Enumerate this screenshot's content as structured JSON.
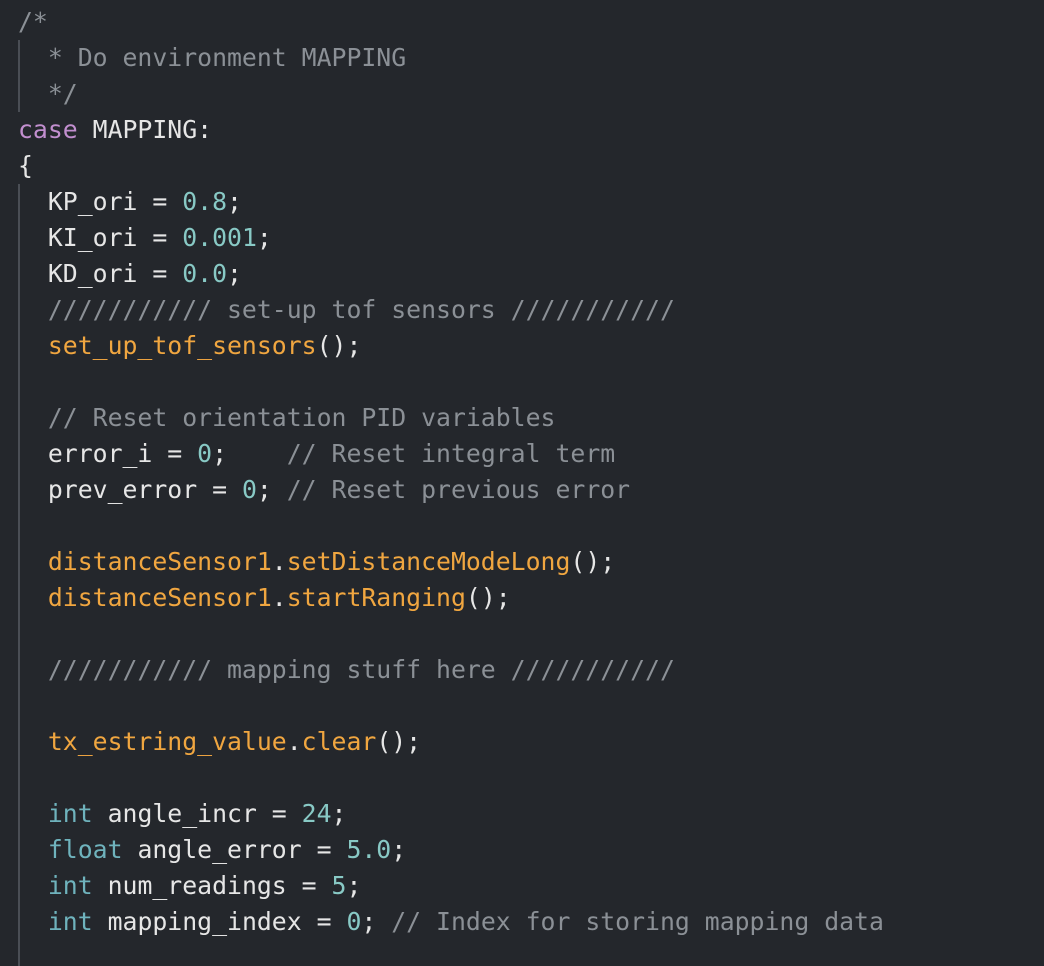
{
  "theme": {
    "background": "#24272c",
    "colors": {
      "plain": "#e6e6e6",
      "comment": "#8b9096",
      "keyword": "#c28fcf",
      "number": "#88c9c5",
      "function": "#f0a640",
      "type": "#6fb3bd",
      "indent_guide": "#4a4e55"
    }
  },
  "code": {
    "lines": [
      [
        [
          "comment",
          "/*"
        ]
      ],
      [
        [
          "comment",
          "  * Do environment MAPPING"
        ]
      ],
      [
        [
          "comment",
          "  */"
        ]
      ],
      [
        [
          "keyword",
          "case"
        ],
        [
          "plain",
          " MAPPING:"
        ]
      ],
      [
        [
          "plain",
          "{"
        ]
      ],
      [
        [
          "plain",
          "  KP_ori = "
        ],
        [
          "number",
          "0.8"
        ],
        [
          "plain",
          ";"
        ]
      ],
      [
        [
          "plain",
          "  KI_ori = "
        ],
        [
          "number",
          "0.001"
        ],
        [
          "plain",
          ";"
        ]
      ],
      [
        [
          "plain",
          "  KD_ori = "
        ],
        [
          "number",
          "0.0"
        ],
        [
          "plain",
          ";"
        ]
      ],
      [
        [
          "comment",
          "  /////////// set-up tof sensors ///////////"
        ]
      ],
      [
        [
          "plain",
          "  "
        ],
        [
          "func",
          "set_up_tof_sensors"
        ],
        [
          "plain",
          "();"
        ]
      ],
      [],
      [
        [
          "comment",
          "  // Reset orientation PID variables"
        ]
      ],
      [
        [
          "plain",
          "  error_i = "
        ],
        [
          "number",
          "0"
        ],
        [
          "plain",
          ";    "
        ],
        [
          "comment",
          "// Reset integral term"
        ]
      ],
      [
        [
          "plain",
          "  prev_error = "
        ],
        [
          "number",
          "0"
        ],
        [
          "plain",
          "; "
        ],
        [
          "comment",
          "// Reset previous error"
        ]
      ],
      [],
      [
        [
          "plain",
          "  "
        ],
        [
          "func",
          "distanceSensor1"
        ],
        [
          "plain",
          "."
        ],
        [
          "func",
          "setDistanceModeLong"
        ],
        [
          "plain",
          "();"
        ]
      ],
      [
        [
          "plain",
          "  "
        ],
        [
          "func",
          "distanceSensor1"
        ],
        [
          "plain",
          "."
        ],
        [
          "func",
          "startRanging"
        ],
        [
          "plain",
          "();"
        ]
      ],
      [],
      [
        [
          "comment",
          "  /////////// mapping stuff here ///////////"
        ]
      ],
      [],
      [
        [
          "plain",
          "  "
        ],
        [
          "func",
          "tx_estring_value"
        ],
        [
          "plain",
          "."
        ],
        [
          "func",
          "clear"
        ],
        [
          "plain",
          "();"
        ]
      ],
      [],
      [
        [
          "plain",
          "  "
        ],
        [
          "type",
          "int"
        ],
        [
          "plain",
          " angle_incr = "
        ],
        [
          "number",
          "24"
        ],
        [
          "plain",
          ";"
        ]
      ],
      [
        [
          "plain",
          "  "
        ],
        [
          "type",
          "float"
        ],
        [
          "plain",
          " angle_error = "
        ],
        [
          "number",
          "5.0"
        ],
        [
          "plain",
          ";"
        ]
      ],
      [
        [
          "plain",
          "  "
        ],
        [
          "type",
          "int"
        ],
        [
          "plain",
          " num_readings = "
        ],
        [
          "number",
          "5"
        ],
        [
          "plain",
          ";"
        ]
      ],
      [
        [
          "plain",
          "  "
        ],
        [
          "type",
          "int"
        ],
        [
          "plain",
          " mapping_index = "
        ],
        [
          "number",
          "0"
        ],
        [
          "plain",
          "; "
        ],
        [
          "comment",
          "// Index for storing mapping data"
        ]
      ]
    ]
  }
}
